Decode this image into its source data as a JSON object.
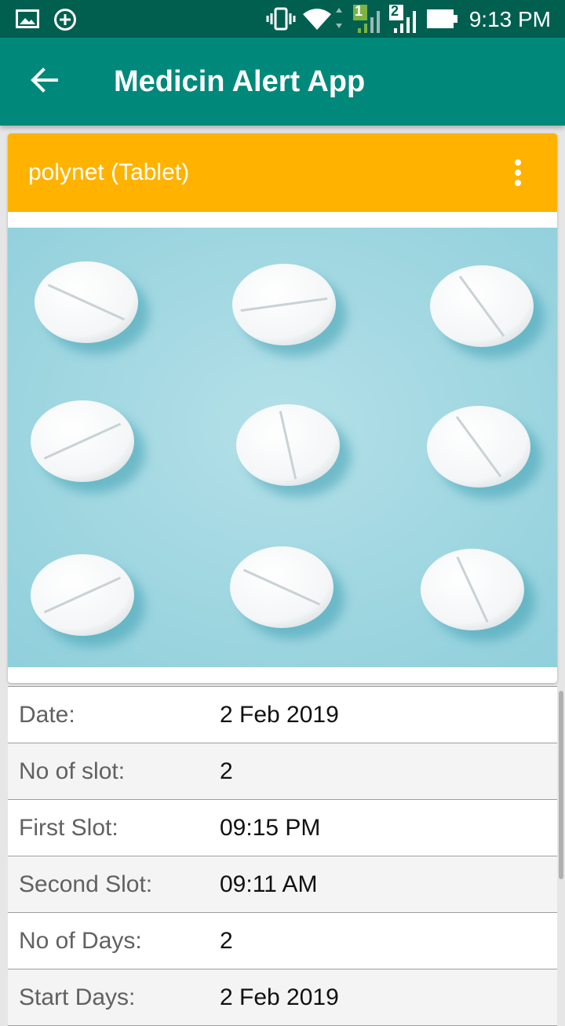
{
  "status_bar": {
    "time": "9:13 PM",
    "icons": [
      "gallery-icon",
      "add-circle-icon",
      "vibrate-icon",
      "wifi-icon",
      "sim1-signal-icon",
      "sim2-signal-icon",
      "battery-icon"
    ],
    "sim1_label": "1",
    "sim2_label": "2"
  },
  "app_bar": {
    "title": "Medicin Alert App",
    "back_icon": "arrow-back-icon",
    "color": "#00897b"
  },
  "card": {
    "title": "polynet (Tablet)",
    "header_color": "#ffb300",
    "menu_icon": "more-vert-icon",
    "image_subject": "white round tablets on light blue background"
  },
  "details": [
    {
      "label": "Date:",
      "value": "2 Feb 2019"
    },
    {
      "label": "No of slot:",
      "value": "2"
    },
    {
      "label": "First Slot:",
      "value": "09:15 PM"
    },
    {
      "label": "Second Slot:",
      "value": "09:11 AM"
    },
    {
      "label": "No of Days:",
      "value": "2"
    },
    {
      "label": "Start Days:",
      "value": "2 Feb 2019"
    }
  ]
}
